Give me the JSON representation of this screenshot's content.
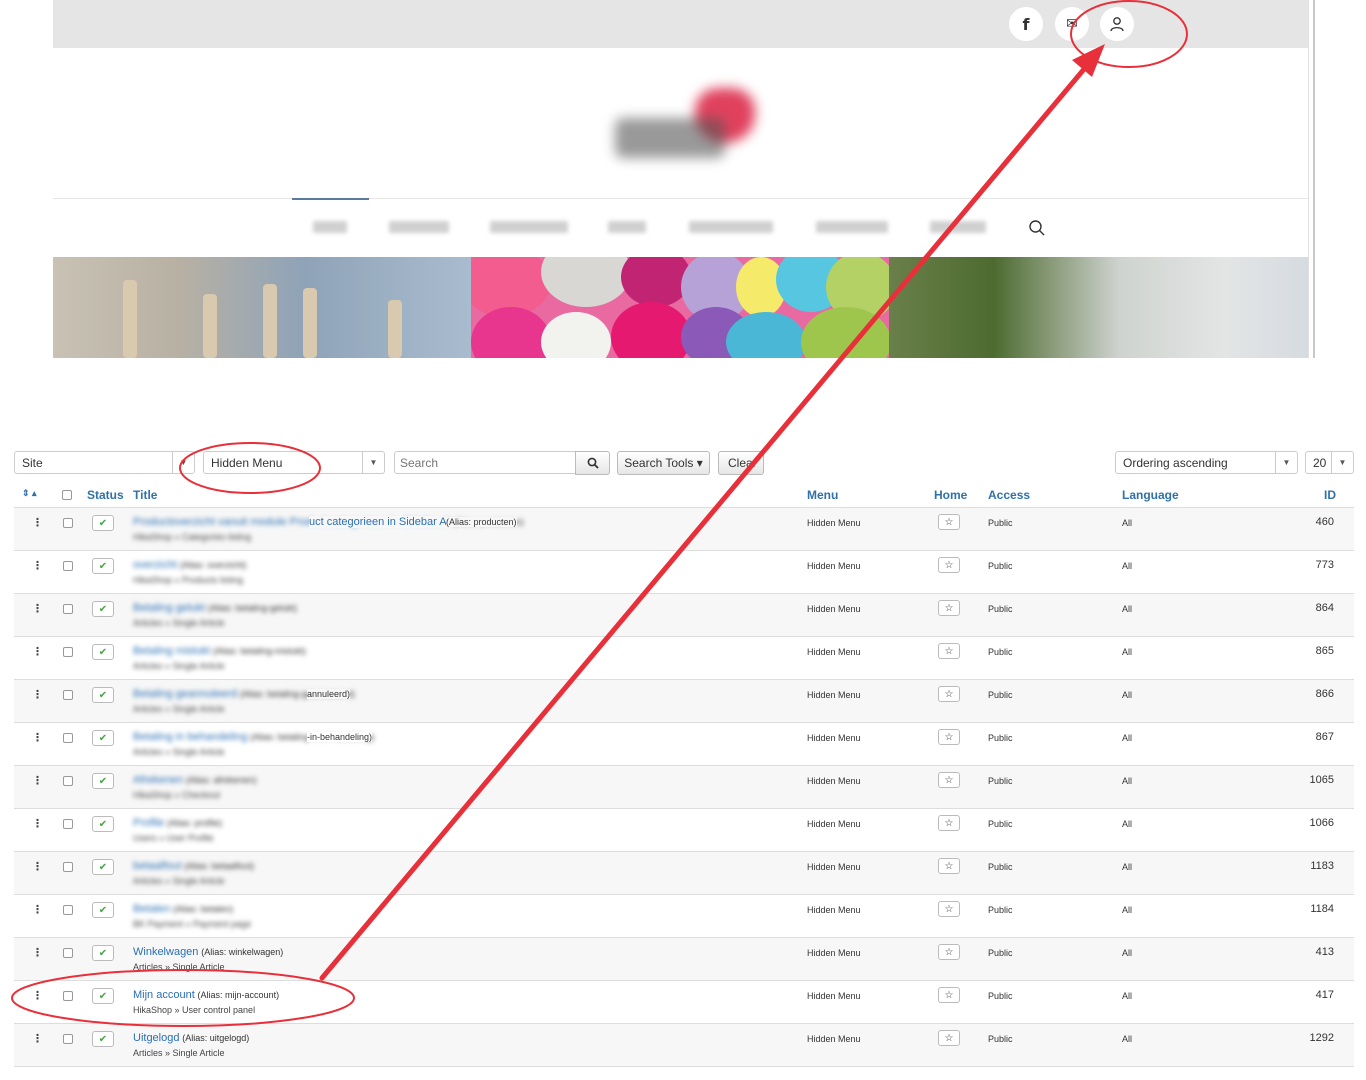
{
  "site": {
    "social_icons": [
      "facebook-icon",
      "mail-icon",
      "user-icon"
    ],
    "social_glyphs": [
      "f",
      "✉",
      "👤"
    ]
  },
  "filters": {
    "client": "Site",
    "menu": "Hidden Menu",
    "search_placeholder": "Search",
    "search_tools": "Search Tools ▾",
    "clear": "Clear",
    "ordering": "Ordering ascending",
    "limit": "20"
  },
  "table": {
    "headers": {
      "sort": "⇕ ▴",
      "status": "Status",
      "title": "Title",
      "menu": "Menu",
      "home": "Home",
      "access": "Access",
      "language": "Language",
      "id": "ID"
    },
    "rows": [
      {
        "title": "Productoverzicht vanuit module Product categorieen in Sidebar A",
        "alias": "(Alias: producten)",
        "sub": "HikaShop » Categories listing",
        "menu": "Hidden Menu",
        "access": "Public",
        "language": "All",
        "id": "460",
        "blur": true,
        "visible_title": "uct categorieen in Sidebar A"
      },
      {
        "title": "overzicht",
        "alias": "(Alias: overzicht)",
        "sub": "HikaShop » Products listing",
        "menu": "Hidden Menu",
        "access": "Public",
        "language": "All",
        "id": "773",
        "blur": true
      },
      {
        "title": "Betaling gelukt",
        "alias": "(Alias: betaling-gelukt)",
        "sub": "Articles » Single Article",
        "menu": "Hidden Menu",
        "access": "Public",
        "language": "All",
        "id": "864",
        "blur": true
      },
      {
        "title": "Betaling mislukt",
        "alias": "(Alias: betaling-mislukt)",
        "sub": "Articles » Single Article",
        "menu": "Hidden Menu",
        "access": "Public",
        "language": "All",
        "id": "865",
        "blur": true
      },
      {
        "title": "Betaling geannuleerd",
        "alias": "(Alias: betaling-geannuleerd)",
        "sub": "Articles » Single Article",
        "menu": "Hidden Menu",
        "access": "Public",
        "language": "All",
        "id": "866",
        "blur": true,
        "visible_tail": "annuleerd)"
      },
      {
        "title": "Betaling in behandeling",
        "alias": "(Alias: betaling-in-behandeling)",
        "sub": "Articles » Single Article",
        "menu": "Hidden Menu",
        "access": "Public",
        "language": "All",
        "id": "867",
        "blur": true,
        "visible_tail": "-in-behandeling)"
      },
      {
        "title": "Afrekenen",
        "alias": "(Alias: afrekenen)",
        "sub": "HikaShop » Checkout",
        "menu": "Hidden Menu",
        "access": "Public",
        "language": "All",
        "id": "1065",
        "blur": true
      },
      {
        "title": "Profile",
        "alias": "(Alias: profile)",
        "sub": "Users » User Profile",
        "menu": "Hidden Menu",
        "access": "Public",
        "language": "All",
        "id": "1066",
        "blur": true
      },
      {
        "title": "betaalfout",
        "alias": "(Alias: betaalfout)",
        "sub": "Articles » Single Article",
        "menu": "Hidden Menu",
        "access": "Public",
        "language": "All",
        "id": "1183",
        "blur": true
      },
      {
        "title": "Betalen",
        "alias": "(Alias: betalen)",
        "sub": "BK Payment » Payment page",
        "menu": "Hidden Menu",
        "access": "Public",
        "language": "All",
        "id": "1184",
        "blur": true
      },
      {
        "title": "Winkelwagen",
        "alias": "(Alias: winkelwagen)",
        "sub": "Articles » Single Article",
        "menu": "Hidden Menu",
        "access": "Public",
        "language": "All",
        "id": "413",
        "blur": false
      },
      {
        "title": "Mijn account",
        "alias": "(Alias: mijn-account)",
        "sub": "HikaShop » User control panel",
        "menu": "Hidden Menu",
        "access": "Public",
        "language": "All",
        "id": "417",
        "blur": false
      },
      {
        "title": "Uitgelogd",
        "alias": "(Alias: uitgelogd)",
        "sub": "Articles » Single Article",
        "menu": "Hidden Menu",
        "access": "Public",
        "language": "All",
        "id": "1292",
        "blur": false
      }
    ]
  },
  "annotation_color": "#e8303a"
}
